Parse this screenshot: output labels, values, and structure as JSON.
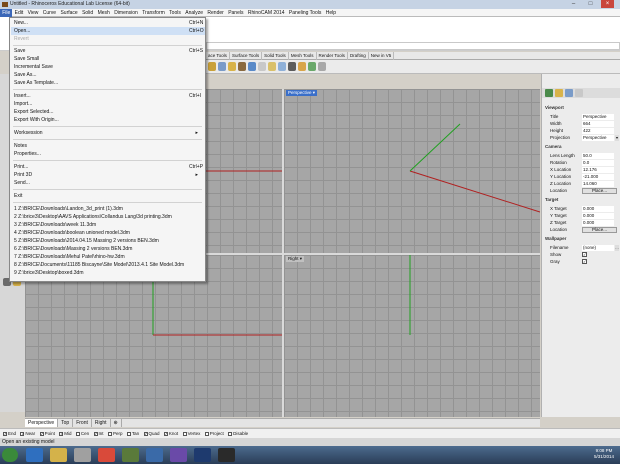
{
  "window": {
    "title": "Untitled - Rhinoceros Educational Lab License (64-bit)"
  },
  "menubar": [
    "File",
    "Edit",
    "View",
    "Curve",
    "Surface",
    "Solid",
    "Mesh",
    "Dimension",
    "Transform",
    "Tools",
    "Analyze",
    "Render",
    "Panels",
    "RhinoCAM 2014",
    "Paneling Tools",
    "Help"
  ],
  "tabs": [
    "ace Tools",
    "Surface Tools",
    "Solid Tools",
    "Mesh Tools",
    "Render Tools",
    "Drafting",
    "New in V5"
  ],
  "file_menu": {
    "new": "New...",
    "new_sc": "Ctrl+N",
    "open": "Open...",
    "open_sc": "Ctrl+O",
    "revert": "Revert",
    "save": "Save",
    "save_sc": "Ctrl+S",
    "save_small": "Save Small",
    "incremental_save": "Incremental Save",
    "save_as": "Save As...",
    "save_as_template": "Save As Template...",
    "insert": "Insert...",
    "insert_sc": "Ctrl+I",
    "import": "Import...",
    "export_selected": "Export Selected...",
    "export_with_origin": "Export With Origin...",
    "worksession": "Worksession",
    "notes": "Notes",
    "properties": "Properties...",
    "print": "Print...",
    "print_sc": "Ctrl+P",
    "print3d": "Print 3D",
    "send": "Send...",
    "exit": "Exit",
    "recent": [
      "1 Z:\\BRICE\\Downloads\\Landon_3d_print (1).3dm",
      "2 Z:\\brice3\\Desktop\\AAVS Applications\\Collandus Lang\\3d printing.3dm",
      "3 Z:\\BRICE\\Downloads\\week 11.3dm",
      "4 Z:\\BRICE\\Downloads\\boolean unioned model.3dm",
      "5 Z:\\BRICE\\Downloads\\2014.04.15 Massing 2 versions BEN.3dm",
      "6 Z:\\BRICE\\Downloads\\Massing 2 versions BEN.3dm",
      "7 Z:\\BRICE\\Downloads\\Mehul Patel\\rhino-hw.3dm",
      "8 Z:\\BRICE\\Documents\\11185 Biscayne\\Site Model\\2013.4.1 Site Model.3dm",
      "9 Z:\\brice3\\Desktop\\boxed.3dm"
    ],
    "submenu_arrow": "▸"
  },
  "viewports": {
    "top_right": "Perspective",
    "bottom_right": "Right",
    "arrow": "▾"
  },
  "panel": {
    "viewport_section": "Viewport",
    "title_k": "Title",
    "title_v": "Perspective",
    "width_k": "Width",
    "width_v": "664",
    "height_k": "Height",
    "height_v": "422",
    "projection_k": "Projection",
    "projection_v": "Perspective",
    "camera_section": "Camera",
    "lens_k": "Lens Length",
    "lens_v": "50.0",
    "rotation_k": "Rotation",
    "rotation_v": "0.0",
    "xloc_k": "X Location",
    "xloc_v": "12.176",
    "yloc_k": "Y Location",
    "yloc_v": "-21.000",
    "zloc_k": "Z Location",
    "zloc_v": "14.060",
    "location_k": "Location",
    "place_btn": "Place...",
    "target_section": "Target",
    "xt_k": "X Target",
    "xt_v": "0.000",
    "yt_k": "Y Target",
    "yt_v": "0.000",
    "zt_k": "Z Target",
    "zt_v": "0.000",
    "location2_k": "Location",
    "place_btn2": "Place...",
    "wallpaper_section": "Wallpaper",
    "filename_k": "Filename",
    "filename_v": "(none)",
    "show_k": "Show",
    "gray_k": "Gray",
    "check": "✓"
  },
  "viewport_tabs": [
    "Perspective",
    "Top",
    "Front",
    "Right"
  ],
  "osnaps": [
    "End",
    "Near",
    "Point",
    "Mid",
    "Cen",
    "Int",
    "Perp",
    "Tan",
    "Quad",
    "Knot",
    "Vertex",
    "Project",
    "Disable"
  ],
  "status": "Open an existing model",
  "clock": {
    "time": "9:08 PM",
    "date": "5/31/2014"
  }
}
